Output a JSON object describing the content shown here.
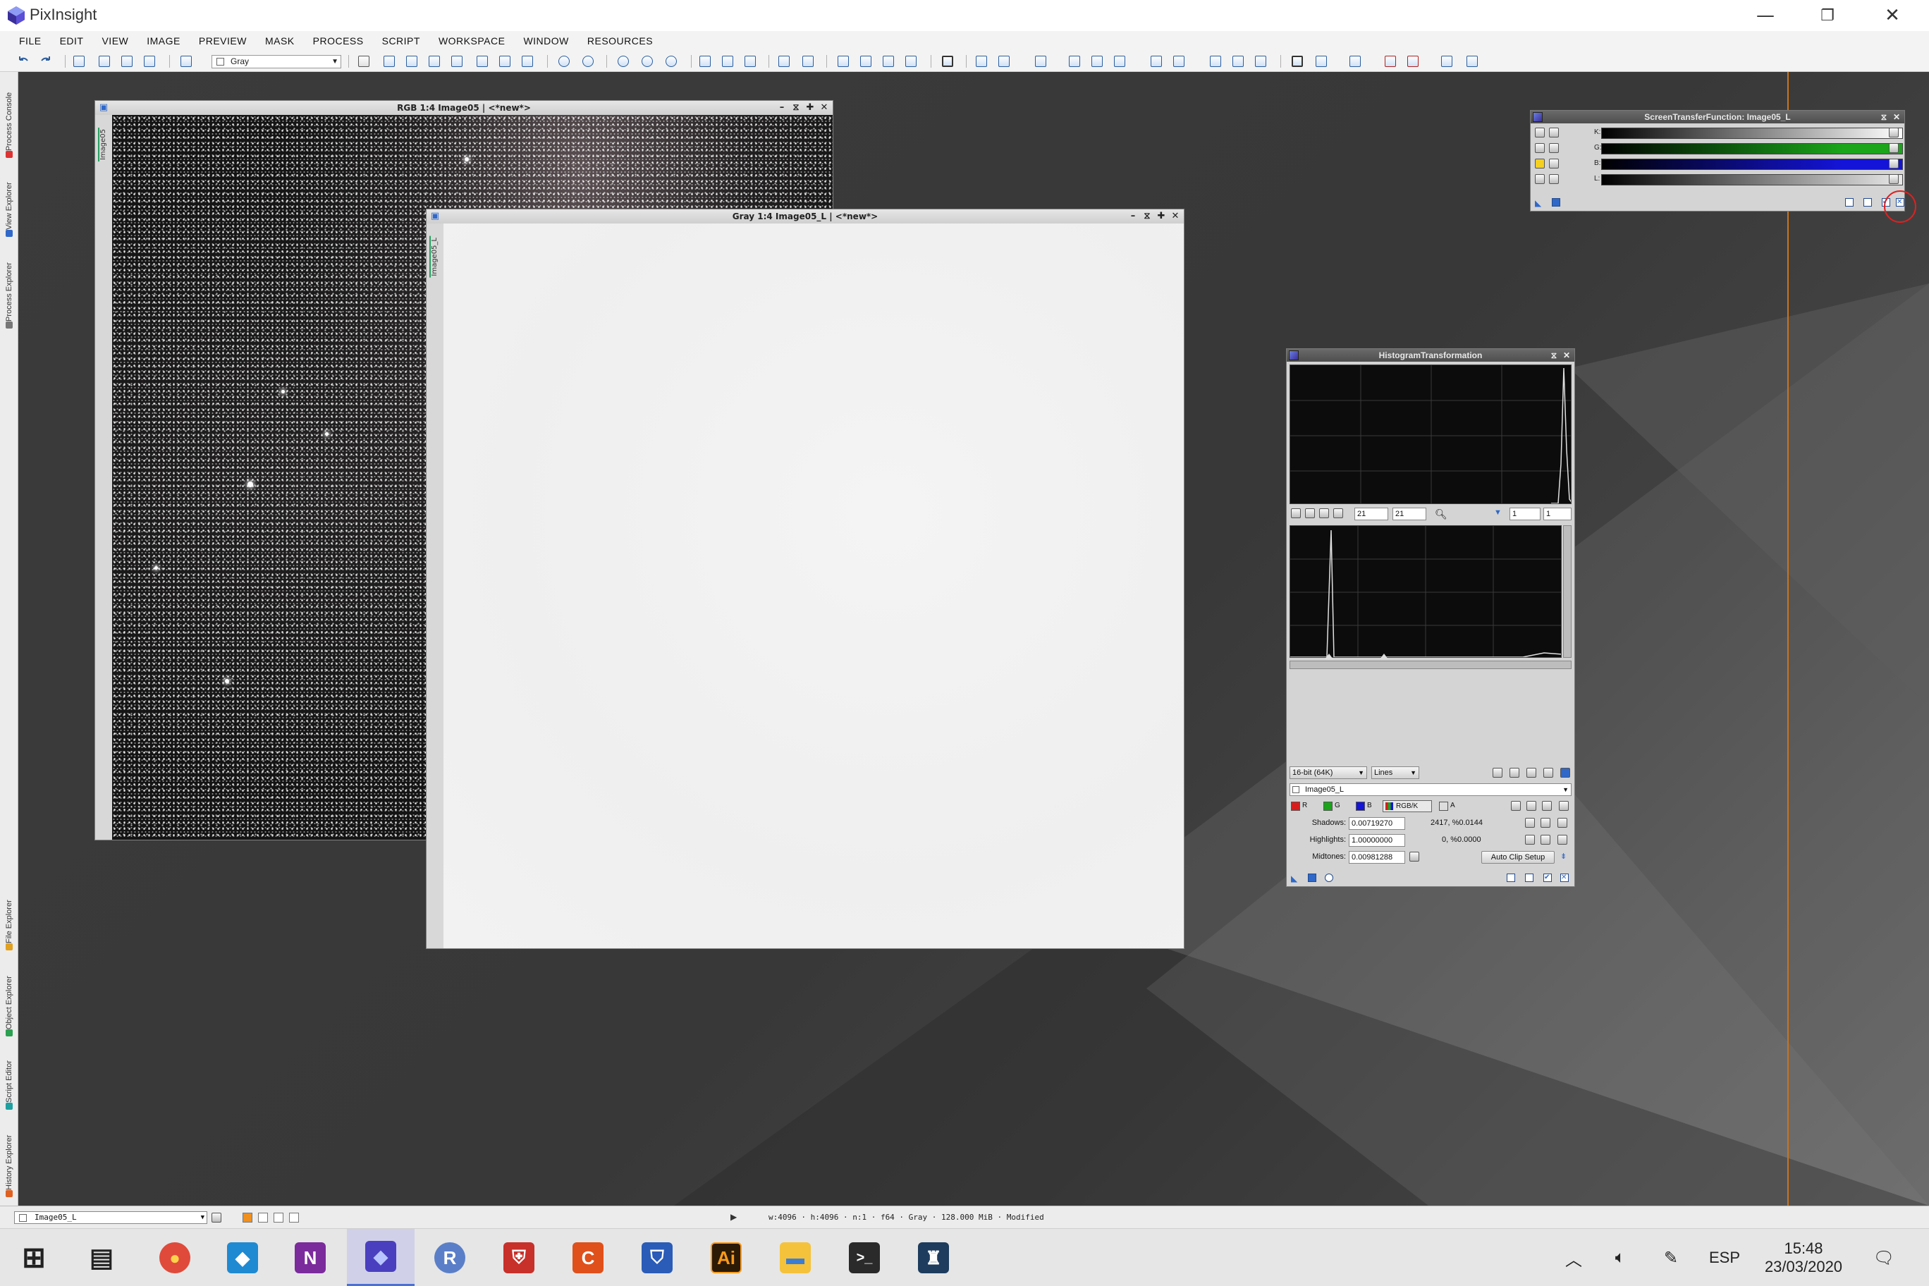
{
  "app": {
    "title": "PixInsight",
    "colors": {
      "accent": "#4a6fd6",
      "stf_red": "#ff0000",
      "stf_green": "#1aa51a",
      "stf_blue": "#1414d8"
    }
  },
  "window_controls": {
    "minimize": "—",
    "restore": "❐",
    "close": "✕"
  },
  "menu": [
    "FILE",
    "EDIT",
    "VIEW",
    "IMAGE",
    "PREVIEW",
    "MASK",
    "PROCESS",
    "SCRIPT",
    "WORKSPACE",
    "WINDOW",
    "RESOURCES"
  ],
  "toolbar": {
    "view_selector_value": "Gray"
  },
  "left_dock": {
    "tabs": [
      "Process Console",
      "View Explorer",
      "Process Explorer",
      "File Explorer",
      "Object Explorer",
      "Script Editor",
      "History Explorer"
    ]
  },
  "windows": {
    "rgb": {
      "title": "RGB 1:4 Image05 | <*new*>",
      "side_label": "Image05"
    },
    "gray": {
      "title": "Gray 1:4 Image05_L | <*new*>",
      "side_label": "Image05_L"
    }
  },
  "stf": {
    "title": "ScreenTransferFunction: Image05_L",
    "channels": [
      {
        "label": "K:",
        "color": "linear-gradient(90deg,#000,#fff)"
      },
      {
        "label": "G:",
        "color": "linear-gradient(90deg,#000,#1aa51a 80%)"
      },
      {
        "label": "B:",
        "color": "linear-gradient(90deg,#000,#1414d8 80%)"
      },
      {
        "label": "L:",
        "color": "linear-gradient(90deg,#000,#e8e8e8)"
      }
    ]
  },
  "histogram": {
    "title": "HistogramTransformation",
    "zoom_h": "21",
    "zoom_v": "21",
    "scale_a": "1",
    "scale_b": "1",
    "resolution": "16-bit (64K)",
    "graph_style": "Lines",
    "target_view": "Image05_L",
    "channel_r": "R",
    "channel_g": "G",
    "channel_b": "B",
    "channel_rgbk": "RGB/K",
    "channel_a": "A",
    "shadows_label": "Shadows:",
    "shadows_value": "0.00719270",
    "shadows_stats": "2417, %0.0144",
    "highlights_label": "Highlights:",
    "highlights_value": "1.00000000",
    "highlights_stats": "0, %0.0000",
    "midtones_label": "Midtones:",
    "midtones_value": "0.00981288",
    "auto_clip_label": "Auto Clip Setup"
  },
  "statusbar": {
    "view_selector": "Image05_L",
    "info": "w:4096 · h:4096 · n:1 · f64 · Gray · 128.000 MiB · Modified"
  },
  "taskbar": {
    "apps": [
      {
        "name": "Windows Start",
        "glyph": "⊞",
        "bg": "transparent",
        "fg": "#222"
      },
      {
        "name": "Task View",
        "glyph": "▤",
        "bg": "transparent",
        "fg": "#222"
      },
      {
        "name": "Chrome",
        "glyph": "●",
        "bg": "#e04a3a",
        "fg": "#fcd24a"
      },
      {
        "name": "VS Code",
        "glyph": "◆",
        "bg": "#1f8ad2",
        "fg": "#ffffff"
      },
      {
        "name": "OneNote",
        "glyph": "N",
        "bg": "#7b2b9c",
        "fg": "#ffffff"
      },
      {
        "name": "PixInsight",
        "glyph": "◆",
        "bg": "#4a3fbf",
        "fg": "#b8c4ff"
      },
      {
        "name": "R",
        "glyph": "R",
        "bg": "#5a7fc8",
        "fg": "#ffffff"
      },
      {
        "name": "Shield",
        "glyph": "⛨",
        "bg": "#c8302a",
        "fg": "#ffffff"
      },
      {
        "name": "CCleaner",
        "glyph": "C",
        "bg": "#e0501a",
        "fg": "#ffffff"
      },
      {
        "name": "Bitwarden",
        "glyph": "⛉",
        "bg": "#2a5cb8",
        "fg": "#ffffff"
      },
      {
        "name": "Illustrator",
        "glyph": "Ai",
        "bg": "#2b1a05",
        "fg": "#f99a1c"
      },
      {
        "name": "File Explorer",
        "glyph": "▬",
        "bg": "#f4c23b",
        "fg": "#3a7dd6"
      },
      {
        "name": "Terminal",
        "glyph": ">_",
        "bg": "#2a2a2a",
        "fg": "#ffffff"
      },
      {
        "name": "Kindle",
        "glyph": "♜",
        "bg": "#1d3c5e",
        "fg": "#ffffff"
      }
    ],
    "tray": {
      "language": "ESP",
      "time": "15:48",
      "date": "23/03/2020"
    }
  }
}
